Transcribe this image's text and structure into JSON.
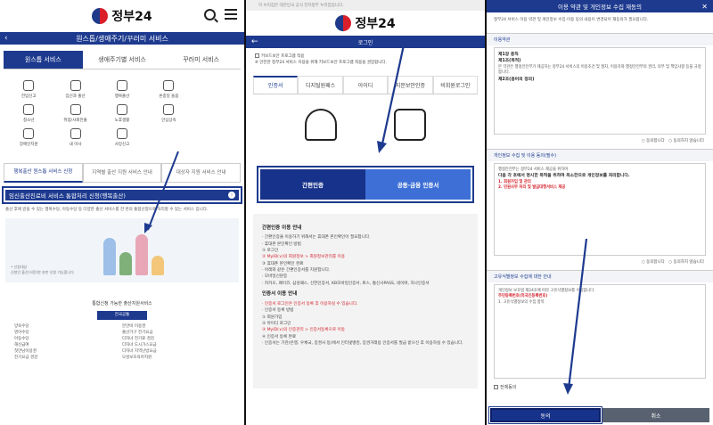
{
  "brand": {
    "name": "정부24"
  },
  "panel1": {
    "navbar": "원스톱/생애주기/꾸러미 서비스",
    "tabs": [
      "원스톱 서비스",
      "생애주기별 서비스",
      "꾸러미 서비스"
    ],
    "icons": [
      "전입신고",
      "임신과 출산",
      "행복출산",
      "온종일 돌봄",
      "",
      "청소년",
      "취업/사회진출",
      "노후생활",
      "안심상속",
      "",
      "장애인지원",
      "내 이사",
      "사망신고",
      "",
      ""
    ],
    "subtabs": [
      "행복출산 원스톱 서비스 신청",
      "지역별 출산 지원 서비스 안내",
      "대상자 지원 서비스 안내"
    ],
    "highlight": "임신출산진료비 서비스 통합처리 신청(행복출산)",
    "description": "출산 후에 받을 수 있는 행복수당, 아동수당 등 다양한 출산 서비스를 한 번의 통합신청으로 처리할 수 있는 서비스 입니다.",
    "caption": [
      "• 신청대상",
      "신청인 출산(사망)한 분만 신청 가능합니다"
    ],
    "list_title": "통합신청 가능한 출산지원서비스",
    "list_button": "전국공통",
    "list_left": [
      "양육수당",
      "영아수당",
      "아동수당",
      "해산급여",
      "첫만남이용권",
      "전기요금 경감"
    ],
    "list_right": [
      "분만비 이용권",
      "출산가구 전기요금",
      "다자녀 전기료 경감",
      "다자녀 도시가스요금",
      "다자녀 지역난방요금",
      "모성보호육아지원"
    ]
  },
  "panel2": {
    "alert": "이 누리집은 대한민국 공식 전자정부 누리집입니다.",
    "navbar": "로그인",
    "checks": [
      "키보드보안 프로그램 적용",
      "※ 안전한 정부24 서비스 이용을 위해 키보드보안 프로그램 적용을 권장합니다."
    ],
    "tabs": [
      "인증서",
      "디지털원패스",
      "아이디",
      "지문보안인증",
      "비회원로그인"
    ],
    "buttons": {
      "simple": "간편인증",
      "joint": "공동·금융 인증서"
    },
    "guide": {
      "title1": "간편인증 이용 안내",
      "lines1": [
        "· 간편인증을 이용하기 위해서는 휴대폰 본인확인이 필요합니다.",
        "· 휴대폰 본인확인 방법",
        "① 로그인",
        "② MyID(∨)의 회원정보 > 회원정보관리를 이용",
        "③ 휴대폰 본인확인 완료",
        "· 아래와 같은 간편인증서를 지원합니다.",
        "· 모바일신분증",
        "· 카카오, 페이코, 삼성패스, 신한인증서, KB모바일인증서, 토스, 통신사PASS, 네이버, 하나인증서"
      ],
      "title2": "인증서 이용 안내",
      "lines2": [
        "· 인증서 로그인은 인증서 등록 후 이용하실 수 있습니다.",
        "· 인증서 등록 방법",
        "① 회원가입",
        "② 아이디 로그인",
        "③ MyID(∨)의 인증관리 > 인증서등록으로 이동",
        "④ 인증서 등록 완료",
        "· 인증서는 기관(은행, 우체국, 증권사 등)에서 인터넷뱅킹, 증권거래용 인증서를 발급 받으신 후 이용하실 수 있습니다."
      ]
    }
  },
  "panel3": {
    "title": "이용 약관 및 개인정보 수집 재동의",
    "intro": "정부24 서비스 이용 약관 및 개인정보 수집·이용 동의 내용이 변경되어 재동의가 필요합니다.",
    "sections": [
      "이용약관",
      "개인정보 수집 및 이용 동의(필수)",
      "고유식별정보 수집에 대한 안내"
    ],
    "terms": [
      "제1장 총칙",
      "제1조(목적)",
      "본 약관은 행정안전부가 제공하는 정부24 서비스의 이용조건 및 절차, 이용자와 행정안전부의 권리, 의무 및 책임사항 등을 규정합니다.",
      "제2조(용어의 정의)"
    ],
    "privacy": [
      "행정안전부는 정부24 서비스 제공을 위하여",
      "다음 각 호에서 명시한 목적을 위하여 최소한으로 개인정보를 처리합니다.",
      "1. 회원가입 및 관리",
      "2. 민원사무 처리 및 발급대행서비스 제공"
    ],
    "unique": [
      "개인정보 보호법 제24조에 따라 고유식별정보를 수집합니다.",
      "주민등록번호(외국인등록번호)",
      "1. 고유식별정보의 수집 항목"
    ],
    "radios": [
      "동의합니다",
      "동의하지 않습니다"
    ],
    "all_agree": "전체동의",
    "btn_agree": "동의",
    "btn_cancel": "취소"
  },
  "colors": {
    "primary": "#1d3a8f",
    "secondary": "#3d6fd6",
    "alert": "#d4212a"
  }
}
